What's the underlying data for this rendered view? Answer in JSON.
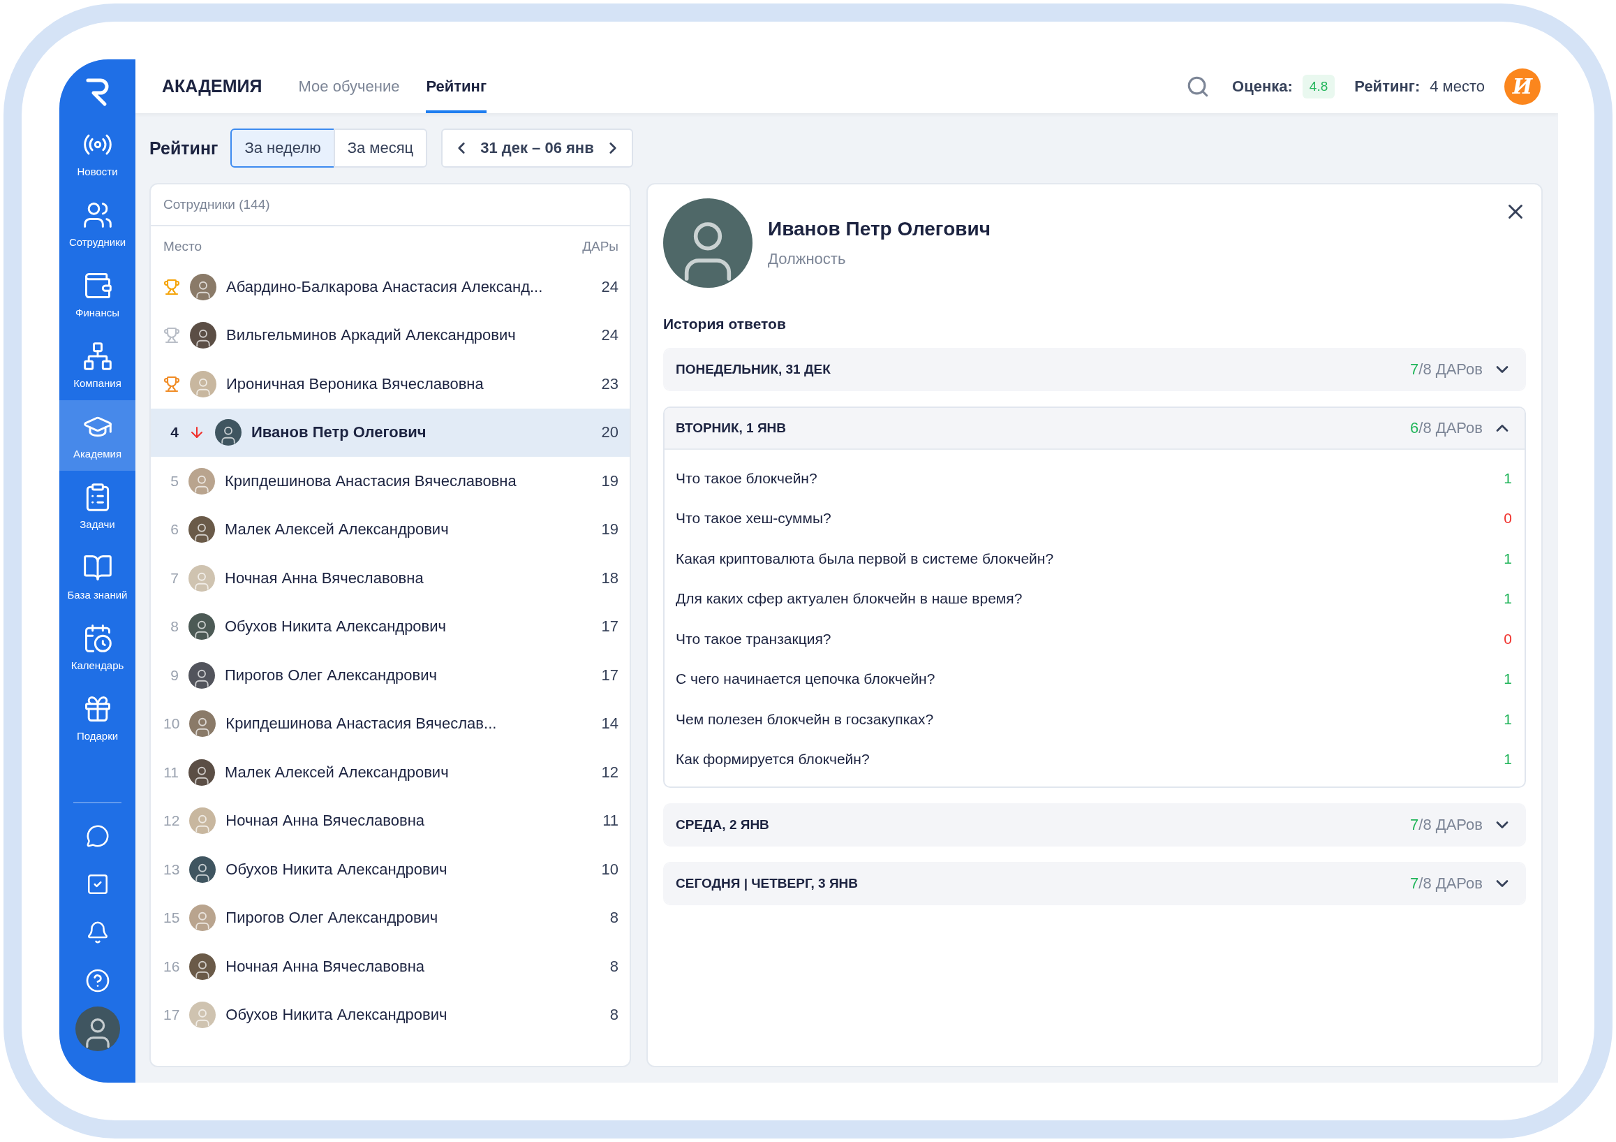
{
  "sidebar": {
    "items": [
      {
        "label": "Новости",
        "selected": false
      },
      {
        "label": "Сотрудники",
        "selected": false
      },
      {
        "label": "Финансы",
        "selected": false
      },
      {
        "label": "Компания",
        "selected": false
      },
      {
        "label": "Академия",
        "selected": true
      },
      {
        "label": "Задачи",
        "selected": false
      },
      {
        "label": "База знаний",
        "selected": false
      },
      {
        "label": "Календарь",
        "selected": false
      },
      {
        "label": "Подарки",
        "selected": false
      }
    ]
  },
  "header": {
    "title": "АКАДЕМИЯ",
    "tabs": [
      {
        "label": "Мое обучение",
        "selected": false
      },
      {
        "label": "Рейтинг",
        "selected": true
      }
    ],
    "score_label": "Оценка:",
    "score": "4.8",
    "rating_label": "Рейтинг:",
    "rating": "4 место",
    "user_initial": "И"
  },
  "toolbar": {
    "title": "Рейтинг",
    "periods": [
      {
        "label": "За неделю",
        "selected": true
      },
      {
        "label": "За месяц",
        "selected": false
      }
    ],
    "date_range": "31 дек – 06 янв"
  },
  "employees": {
    "title": "Сотрудники (144)",
    "columns": [
      "Место",
      "ДАРы"
    ],
    "rows": [
      {
        "kind": "trophy",
        "color": "#f5a50c",
        "dropped": false,
        "name": "Абардино-Балкарова Анастасия Александ...",
        "points": "24",
        "selected": false
      },
      {
        "kind": "trophy",
        "color": "#b9bec7",
        "dropped": false,
        "name": "Вильгельминов Аркадий Александрович",
        "points": "24",
        "selected": false
      },
      {
        "kind": "trophy",
        "color": "#f08c26",
        "dropped": false,
        "name": "Ироничная Вероника Вячеславовна",
        "points": "23",
        "selected": false
      },
      {
        "kind": "place",
        "place": "4",
        "dropped": true,
        "name": "Иванов Петр Олегович",
        "points": "20",
        "selected": true
      },
      {
        "kind": "place",
        "place": "5",
        "dropped": false,
        "name": "Крипдешинова Анастасия Вячеславовна",
        "points": "19",
        "selected": false
      },
      {
        "kind": "place",
        "place": "6",
        "dropped": false,
        "name": "Малек Алексей Александрович",
        "points": "19",
        "selected": false
      },
      {
        "kind": "place",
        "place": "7",
        "dropped": false,
        "name": "Ночная Анна Вячеславовна",
        "points": "18",
        "selected": false
      },
      {
        "kind": "place",
        "place": "8",
        "dropped": false,
        "name": "Обухов Никита Александрович",
        "points": "17",
        "selected": false
      },
      {
        "kind": "place",
        "place": "9",
        "dropped": false,
        "name": "Пирогов Олег Александрович",
        "points": "17",
        "selected": false
      },
      {
        "kind": "place",
        "place": "10",
        "dropped": false,
        "name": "Крипдешинова Анастасия Вячеслав...",
        "points": "14",
        "selected": false
      },
      {
        "kind": "place",
        "place": "11",
        "dropped": false,
        "name": "Малек Алексей Александрович",
        "points": "12",
        "selected": false
      },
      {
        "kind": "place",
        "place": "12",
        "dropped": false,
        "name": "Ночная Анна Вячеславовна",
        "points": "11",
        "selected": false
      },
      {
        "kind": "place",
        "place": "13",
        "dropped": false,
        "name": "Обухов Никита Александрович",
        "points": "10",
        "selected": false
      },
      {
        "kind": "place",
        "place": "15",
        "dropped": false,
        "name": "Пирогов Олег Александрович",
        "points": "8",
        "selected": false
      },
      {
        "kind": "place",
        "place": "16",
        "dropped": false,
        "name": "Ночная Анна Вячеславовна",
        "points": "8",
        "selected": false
      },
      {
        "kind": "place",
        "place": "17",
        "dropped": false,
        "name": "Обухов Никита Александрович",
        "points": "8",
        "selected": false
      }
    ]
  },
  "profile": {
    "name": "Иванов Петр Олегович",
    "position": "Должность",
    "section_title": "История ответов",
    "days": [
      {
        "title": "ПОНЕДЕЛЬНИК, 31 ДЕК",
        "earned": "7",
        "total": "/8 ДАРов",
        "expanded": false
      },
      {
        "title": "ВТОРНИК, 1 ЯНВ",
        "earned": "6",
        "total": "/8 ДАРов",
        "expanded": true,
        "answers": [
          {
            "question": "Что такое блокчейн?",
            "score": "1",
            "correct": true
          },
          {
            "question": "Что такое хеш-суммы?",
            "score": "0",
            "correct": false
          },
          {
            "question": "Какая криптовалюта была первой в системе блокчейн?",
            "score": "1",
            "correct": true
          },
          {
            "question": "Для каких сфер актуален блокчейн в наше время?",
            "score": "1",
            "correct": true
          },
          {
            "question": "Что такое транзакция?",
            "score": "0",
            "correct": false
          },
          {
            "question": "С чего начинается цепочка блокчейн?",
            "score": "1",
            "correct": true
          },
          {
            "question": "Чем полезен блокчейн в госзакупках?",
            "score": "1",
            "correct": true
          },
          {
            "question": "Как формируется блокчейн?",
            "score": "1",
            "correct": true
          }
        ]
      },
      {
        "title": "СРЕДА, 2 ЯНВ",
        "earned": "7",
        "total": "/8 ДАРов",
        "expanded": false
      },
      {
        "title": "СЕГОДНЯ | ЧЕТВЕРГ, 3 ЯНВ",
        "earned": "7",
        "total": "/8 ДАРов",
        "expanded": false
      }
    ]
  }
}
